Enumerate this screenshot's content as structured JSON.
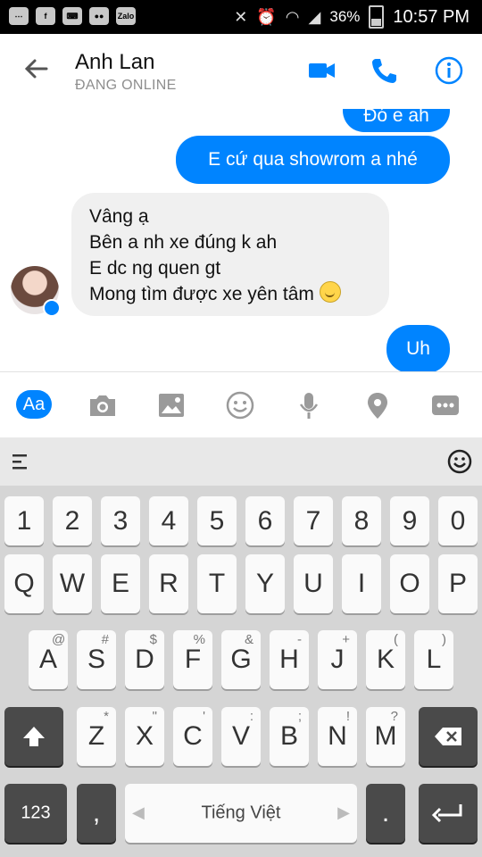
{
  "status_bar": {
    "battery": "36%",
    "time": "10:57 PM",
    "zalo_label": "Zalo"
  },
  "header": {
    "name": "Anh Lan",
    "status": "ĐANG ONLINE"
  },
  "chat": {
    "messages": [
      {
        "text": "Đó e ah"
      },
      {
        "text": "E cứ qua showrom a nhé"
      },
      {
        "lines": [
          "Vâng ạ",
          "Bên a nh xe đúng k ah",
          "E dc ng quen gt",
          "Mong tìm được xe yên tâm"
        ]
      },
      {
        "text": "Uh"
      }
    ]
  },
  "composer": {
    "aa_label": "Aa"
  },
  "keyboard": {
    "num_row": [
      "1",
      "2",
      "3",
      "4",
      "5",
      "6",
      "7",
      "8",
      "9",
      "0"
    ],
    "row1": [
      "Q",
      "W",
      "E",
      "R",
      "T",
      "Y",
      "U",
      "I",
      "O",
      "P"
    ],
    "row2": [
      "A",
      "S",
      "D",
      "F",
      "G",
      "H",
      "J",
      "K",
      "L"
    ],
    "row2_sub": [
      "@",
      "#",
      "$",
      "%",
      "&",
      "-",
      "+",
      "(",
      ")"
    ],
    "row3": [
      "Z",
      "X",
      "C",
      "V",
      "B",
      "N",
      "M"
    ],
    "row3_sub": [
      "*",
      "\"",
      "'",
      ":",
      ";",
      "!",
      "?"
    ],
    "key_123": "123",
    "comma": ",",
    "space_label": "Tiếng Việt",
    "period": "."
  },
  "colors": {
    "accent": "#0084ff",
    "incoming_bubble": "#f0f0f0"
  },
  "icons": [
    "back-arrow-icon",
    "video-call-icon",
    "phone-icon",
    "info-icon",
    "camera-icon",
    "image-icon",
    "emoji-icon",
    "microphone-icon",
    "location-icon",
    "more-icon",
    "menu-icon",
    "emoji-keyboard-icon",
    "shift-icon",
    "backspace-icon",
    "enter-icon"
  ]
}
